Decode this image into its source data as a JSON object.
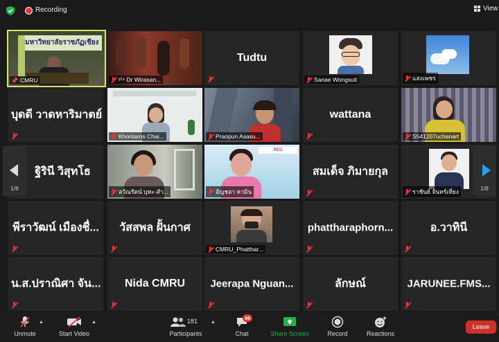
{
  "topbar": {
    "recording_label": "Recording",
    "view_label": "View"
  },
  "tiles": [
    {
      "name": "CMRU",
      "banner": "มหาวิทยาลัยราชภัฏเชียง"
    },
    {
      "name": "ᵞ¹⁴ Dr Wirasan..."
    },
    {
      "name": "Tudtu"
    },
    {
      "name": "Sanae Wongsuit"
    },
    {
      "name": "แสงเพชร"
    },
    {
      "name": "บุดดี วาดหาริมาตย์"
    },
    {
      "name": "Khontaros Chai..."
    },
    {
      "name": "Praopun Asasu..."
    },
    {
      "name": "wattana"
    },
    {
      "name": "S541207uchanart"
    },
    {
      "name": "ฐิรินี วิสุทโธ"
    },
    {
      "name": "ลวัณรัตน์ บุหะ-สำ..."
    },
    {
      "name": "อัญชลา หามิน"
    },
    {
      "name": "สมเด็จ ภิมายกุล"
    },
    {
      "name": "ราชันย์ จันทร์เที่ยง"
    },
    {
      "name": "พีราวัฒน์ เมืองชื่..."
    },
    {
      "name": "วัสสพล ฝั้นกาศ"
    },
    {
      "name": "CMRU_Phatthar..."
    },
    {
      "name": "phattharaphorn..."
    },
    {
      "name": "อ.วาทินี"
    },
    {
      "name": "น.ส.ปราณิศา จัน..."
    },
    {
      "name": "Nida CMRU"
    },
    {
      "name": "Jeerapa Nguan..."
    },
    {
      "name": "ลักษณ์"
    },
    {
      "name": "JARUNEE.FMS..."
    }
  ],
  "pager": {
    "left": "1/8",
    "right": "1/8"
  },
  "toolbar": {
    "unmute": "Unmute",
    "start_video": "Start Video",
    "participants": "Participants",
    "participant_count": "181",
    "chat": "Chat",
    "chat_badge": "66",
    "share_screen": "Share Screen",
    "record": "Record",
    "reactions": "Reactions",
    "leave": "Leave"
  },
  "colors": {
    "background": "#1a1a1a",
    "tile": "#262626",
    "active_border": "#d8e86a",
    "muted_red": "#e33333",
    "share_green": "#22b24c",
    "leave_red": "#d0302a"
  }
}
